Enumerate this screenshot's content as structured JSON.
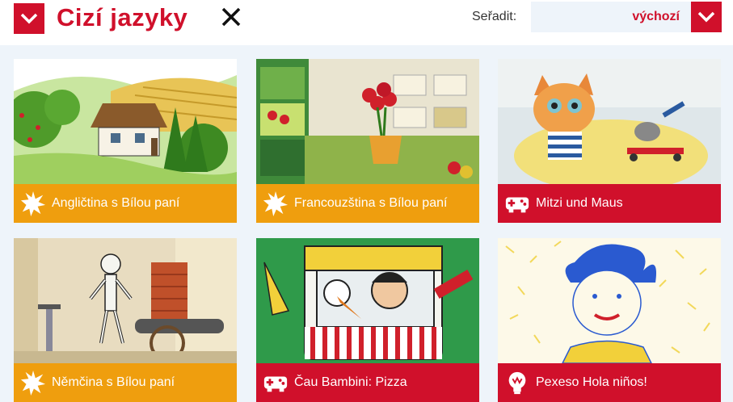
{
  "header": {
    "title": "Cizí jazyky",
    "sort_label": "Seřadit:",
    "sort_value": "výchozí"
  },
  "colors": {
    "brand_red": "#d0102b",
    "orange": "#ef9e0e",
    "grid_background": "#eef4fa"
  },
  "cards": [
    {
      "label": "Angličtina s Bílou paní",
      "icon": "star-burst-icon",
      "bar": "orange"
    },
    {
      "label": "Francouzština s Bílou paní",
      "icon": "star-burst-icon",
      "bar": "orange"
    },
    {
      "label": "Mitzi und Maus",
      "icon": "gamepad-icon",
      "bar": "red"
    },
    {
      "label": "Němčina s Bílou paní",
      "icon": "star-burst-icon",
      "bar": "orange"
    },
    {
      "label": "Čau Bambini: Pizza",
      "icon": "gamepad-icon",
      "bar": "red"
    },
    {
      "label": "Pexeso Hola niños!",
      "icon": "lightbulb-icon",
      "bar": "red"
    }
  ]
}
